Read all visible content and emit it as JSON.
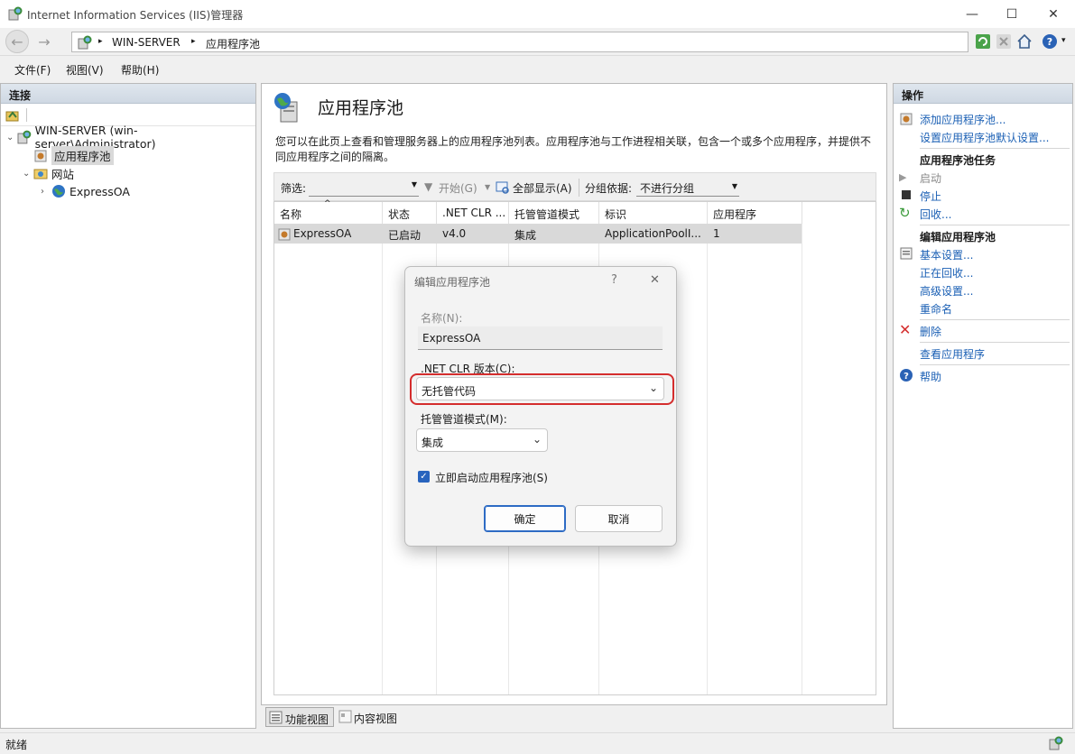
{
  "window": {
    "title": "Internet Information Services (IIS)管理器",
    "minimize_glyph": "—",
    "maximize_glyph": "☐",
    "close_glyph": "✕"
  },
  "address": {
    "crumb1": "WIN-SERVER",
    "crumb2": "应用程序池",
    "sep": "▸"
  },
  "menu": [
    "文件(F)",
    "视图(V)",
    "帮助(H)"
  ],
  "connections": {
    "header": "连接",
    "server": "WIN-SERVER (win-server\\Administrator)",
    "app_pools": "应用程序池",
    "sites": "网站",
    "site1": "ExpressOA"
  },
  "feature": {
    "title": "应用程序池",
    "description": "您可以在此页上查看和管理服务器上的应用程序池列表。应用程序池与工作进程相关联，包含一个或多个应用程序，并提供不同应用程序之间的隔离。"
  },
  "filter": {
    "label": "筛选:",
    "start": "开始(G)",
    "show_all": "全部显示(A)",
    "group_label": "分组依据:",
    "group_value": "不进行分组"
  },
  "grid": {
    "columns": [
      "名称",
      "状态",
      ".NET CLR ...",
      "托管管道模式",
      "标识",
      "应用程序"
    ],
    "rows": [
      [
        "ExpressOA",
        "已启动",
        "v4.0",
        "集成",
        "ApplicationPoolI...",
        "1"
      ]
    ]
  },
  "views": {
    "features": "功能视图",
    "content": "内容视图"
  },
  "actions": {
    "header": "操作",
    "add_pool": "添加应用程序池...",
    "set_defaults": "设置应用程序池默认设置...",
    "pool_tasks": "应用程序池任务",
    "start": "启动",
    "stop": "停止",
    "recycle": "回收...",
    "edit_pool": "编辑应用程序池",
    "basic": "基本设置...",
    "recycling": "正在回收...",
    "advanced": "高级设置...",
    "rename": "重命名",
    "delete": "删除",
    "view_apps": "查看应用程序",
    "help": "帮助"
  },
  "status": {
    "text": "就绪"
  },
  "dialog": {
    "title": "编辑应用程序池",
    "help_glyph": "?",
    "close_glyph": "✕",
    "name_label": "名称(N):",
    "name_value": "ExpressOA",
    "clr_label": ".NET CLR 版本(C):",
    "clr_value": "无托管代码",
    "pipeline_label": "托管管道模式(M):",
    "pipeline_value": "集成",
    "autostart_label": "立即启动应用程序池(S)",
    "autostart_checked": true,
    "ok": "确定",
    "cancel": "取消"
  },
  "colors": {
    "link": "#1a5fb4",
    "highlight": "#d42d2d",
    "selected_row": "#d9d9d9"
  }
}
